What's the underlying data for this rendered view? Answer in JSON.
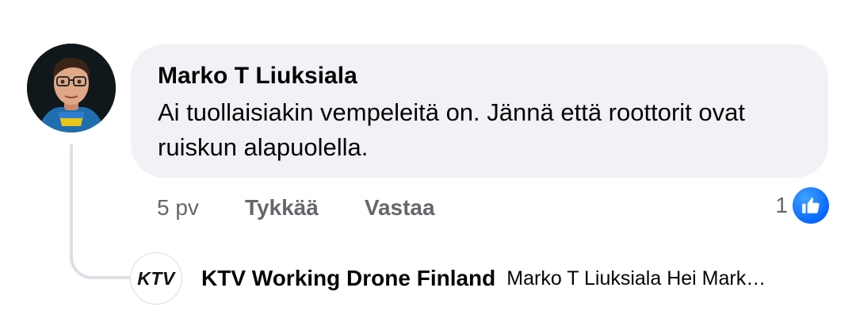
{
  "comment": {
    "author": "Marko T Liuksiala",
    "text": "Ai tuollaisiakin vempeleitä on. Jännä että roottorit ovat ruiskun alapuolella.",
    "time": "5 pv",
    "like_label": "Tykkää",
    "reply_label": "Vastaa",
    "reaction_count": "1",
    "reaction_icon": "like-thumbs-up-icon"
  },
  "reply": {
    "avatar_logo": "KTV",
    "author": "KTV Working Drone Finland",
    "snippet": "Marko T Liuksiala Hei Mark…"
  },
  "colors": {
    "bubble": "#f0f2f5",
    "text": "#050505",
    "secondary_text": "#65676b",
    "like_blue": "#0866ff",
    "thread_line": "#dcdfe4"
  }
}
